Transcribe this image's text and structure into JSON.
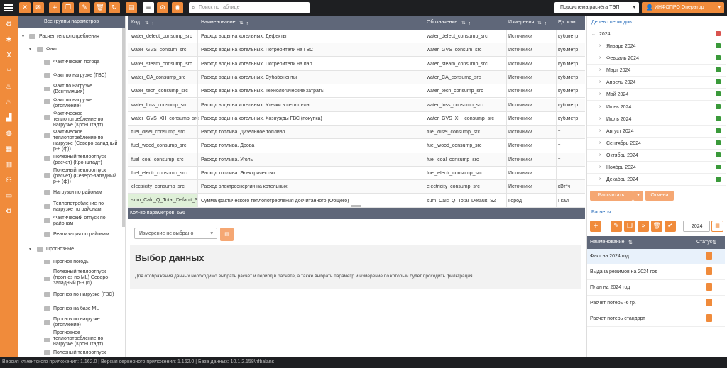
{
  "toolbar": {
    "search_placeholder": "Поиск по таблице",
    "subsystem": "Подсистема расчёта ТЭП",
    "user": "ИНФОПРО Оператор"
  },
  "groups": {
    "header": "Все группы параметров",
    "items": [
      "Расчет теплопотребления",
      "Факт",
      "Фактическая погода",
      "Факт по нагрузке (ГВС)",
      "Факт по нагрузке (Вентиляция)",
      "Факт по нагрузке (отопление)",
      "Фактическое теплопотребление по нагрузке (Кронштадт)",
      "Фактическое теплопотребление по нагрузке (Северо-западный р-н (ф))",
      "Полезный теплоотпуск (расчет) (Кронштадт)",
      "Полезный теплоотпуск (расчет) (Северо-западный р-н (ф))",
      "Нагрузки по районам",
      "Теплопотребление по нагрузке по районам",
      "Фактический отпуск по районам",
      "Реализация по районам",
      "Прогнозные",
      "Прогноз погоды",
      "Полезный теплоотпуск (прогноз по ML) Северо-западный р-н (п)",
      "Прогноз по нагрузке (ГВС)",
      "Прогноз на базе ML",
      "Прогноз по нагрузке (отопление)",
      "Прогнозное теплопотребление по нагрузке (Кронштадт)",
      "Полезный теплоотпуск"
    ]
  },
  "grid": {
    "headers": [
      "Код",
      "Наименование",
      "Обозначение",
      "Измерения",
      "Ед. изм."
    ],
    "rows": [
      [
        "water_defect_consump_src",
        "Расход воды на котельных. Дефекты",
        "water_defect_consump_src",
        "Источники",
        "куб.метр"
      ],
      [
        "water_GVS_consum_src",
        "Расход воды на котельных. Потребители на ГВС",
        "water_GVS_consum_src",
        "Источники",
        "куб.метр"
      ],
      [
        "water_steam_consump_src",
        "Расход воды на котельных. Потребители на пар",
        "water_steam_consump_src",
        "Источники",
        "куб.метр"
      ],
      [
        "water_CA_consump_src",
        "Расход воды на котельных. Субабоненты",
        "water_CA_consump_src",
        "Источники",
        "куб.метр"
      ],
      [
        "water_tech_consump_src",
        "Расход воды на котельных. Технологические затраты",
        "water_tech_consump_src",
        "Источники",
        "куб.метр"
      ],
      [
        "water_loss_consump_src",
        "Расход воды на котельных. Утечки в сети ф-ла",
        "water_loss_consump_src",
        "Источники",
        "куб.метр"
      ],
      [
        "water_GVS_XH_consump_src",
        "Расход воды на котельных. Хознужды ГВС (покупка)",
        "water_GVS_XH_consump_src",
        "Источники",
        "куб.метр"
      ],
      [
        "fuel_disel_consump_src",
        "Расход топлива. Дизельное топливо",
        "fuel_disel_consump_src",
        "Источники",
        "т"
      ],
      [
        "fuel_wood_consump_src",
        "Расход топлива. Дрова",
        "fuel_wood_consump_src",
        "Источники",
        "т"
      ],
      [
        "fuel_coal_consump_src",
        "Расход топлива. Уголь",
        "fuel_coal_consump_src",
        "Источники",
        "т"
      ],
      [
        "fuel_electr_consump_src",
        "Расход топлива. Электричество",
        "fuel_electr_consump_src",
        "Источники",
        "т"
      ],
      [
        "electricity_consump_src",
        "Расход электроэнергии на котельных",
        "electricity_consump_src",
        "Источники",
        "кВт*ч"
      ],
      [
        "sum_Calc_Q_Total_Default_SZ",
        "Сумма фактического теплопотребления досчитанного (Общего)",
        "sum_Calc_Q_Total_Default_SZ",
        "Город",
        "Гкал"
      ]
    ],
    "count": "Кол-во параметров: 636"
  },
  "lower": {
    "measure_placeholder": "Измерение не выбрано",
    "title": "Выбор данных",
    "text": "Для отображения данных необходимо выбрать расчёт и период в расчёте, а также выбрать параметр и измерение по которым будет проходить фильтрация."
  },
  "periods": {
    "title": "Дерево периодов",
    "year": "2024",
    "months": [
      "Январь 2024",
      "Февраль 2024",
      "Март 2024",
      "Апрель 2024",
      "Май 2024",
      "Июнь 2024",
      "Июль 2024",
      "Август 2024",
      "Сентябрь 2024",
      "Октябрь 2024",
      "Ноябрь 2024",
      "Декабрь 2024"
    ],
    "calc_button": "Рассчитать",
    "cancel_button": "Отмена"
  },
  "calcs": {
    "title": "Расчеты",
    "year": "2024",
    "headers": [
      "Наименование",
      "Статус"
    ],
    "rows": [
      "Факт на 2024 год",
      "Выдача режимов на 2024 год",
      "План на 2024 год",
      "Расчет потерь -6 гр.",
      "Расчет потерь стандарт"
    ]
  },
  "footer": "Версия клиентского приложения: 1.162.0 | Версия серверного приложения: 1.162.0 | База данных: 10.1.2.158\\nfbalans"
}
